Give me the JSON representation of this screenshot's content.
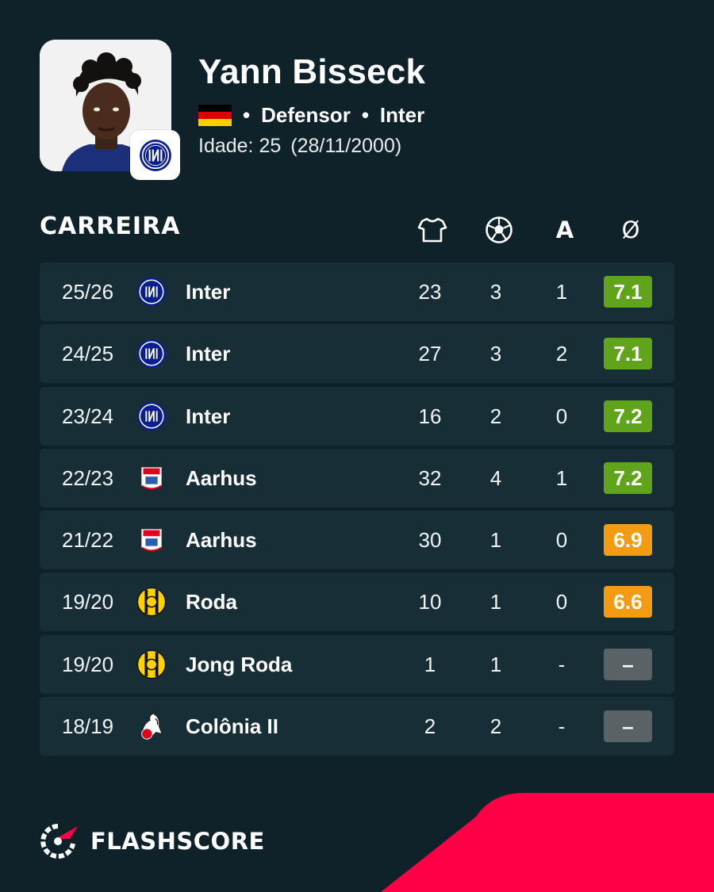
{
  "player": {
    "name": "Yann Bisseck",
    "position": "Defensor",
    "club": "Inter",
    "age_label": "Idade: 25",
    "birthdate": "(28/11/2000)",
    "flag_colors": [
      "#000000",
      "#dd0000",
      "#ffce00"
    ]
  },
  "career": {
    "title": "CARREIRA",
    "columns": {
      "appearances_icon": "shirt-icon",
      "goals_icon": "ball-icon",
      "assists_label": "A",
      "rating_label": "Ø"
    },
    "rows": [
      {
        "season": "25/26",
        "club": "Inter",
        "logo": "inter",
        "apps": "23",
        "goals": "3",
        "assists": "1",
        "rating": "7.1",
        "rating_color": "#5fa41a"
      },
      {
        "season": "24/25",
        "club": "Inter",
        "logo": "inter",
        "apps": "27",
        "goals": "3",
        "assists": "2",
        "rating": "7.1",
        "rating_color": "#5fa41a"
      },
      {
        "season": "23/24",
        "club": "Inter",
        "logo": "inter",
        "apps": "16",
        "goals": "2",
        "assists": "0",
        "rating": "7.2",
        "rating_color": "#5fa41a"
      },
      {
        "season": "22/23",
        "club": "Aarhus",
        "logo": "aarhus",
        "apps": "32",
        "goals": "4",
        "assists": "1",
        "rating": "7.2",
        "rating_color": "#5fa41a"
      },
      {
        "season": "21/22",
        "club": "Aarhus",
        "logo": "aarhus",
        "apps": "30",
        "goals": "1",
        "assists": "0",
        "rating": "6.9",
        "rating_color": "#f39c12"
      },
      {
        "season": "19/20",
        "club": "Roda",
        "logo": "roda",
        "apps": "10",
        "goals": "1",
        "assists": "0",
        "rating": "6.6",
        "rating_color": "#f39c12"
      },
      {
        "season": "19/20",
        "club": "Jong Roda",
        "logo": "roda",
        "apps": "1",
        "goals": "1",
        "assists": "-",
        "rating": "–",
        "rating_color": "#5b6266"
      },
      {
        "season": "18/19",
        "club": "Colônia II",
        "logo": "koln",
        "apps": "2",
        "goals": "2",
        "assists": "-",
        "rating": "–",
        "rating_color": "#5b6266"
      }
    ]
  },
  "brand": {
    "name": "FLASHSCORE",
    "accent": "#ff0046"
  }
}
